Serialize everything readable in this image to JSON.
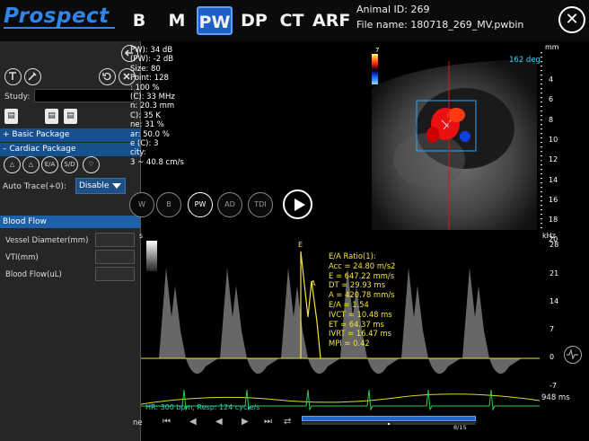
{
  "logo": "Prospect",
  "modes": [
    {
      "label": "B",
      "active": false
    },
    {
      "label": "M",
      "active": false
    },
    {
      "label": "PW",
      "active": true
    },
    {
      "label": "DP",
      "active": false
    },
    {
      "label": "CT",
      "active": false
    },
    {
      "label": "ARF",
      "active": false
    }
  ],
  "animal_id": "Animal ID: 269",
  "file_name": "File name: 180718_269_MV.pwbin",
  "close_label": "✕",
  "left_panel": {
    "study_label": "Study:",
    "study_value": "",
    "basic_package": "+  Basic Package",
    "cardiac_package": "–  Cardiac Package",
    "tri_buttons": [
      "",
      "",
      "E/A",
      "S/D",
      ""
    ],
    "auto_trace_label": "Auto Trace(+0):",
    "auto_trace_value": "Disable",
    "blood_flow_header": "Blood Flow",
    "blood_flow_rows": [
      {
        "label": "Vessel Diameter(mm)",
        "value": ""
      },
      {
        "label": "VTI(mm)",
        "value": ""
      },
      {
        "label": "Blood Flow(uL)",
        "value": ""
      }
    ]
  },
  "params_text": "PW): 34 dB\n(PW): -2 dB\nSize: 80\nPoint: 128\n: 100 %\n(C): 33 MHz\nn: 20.3 mm\nC): 35 K\nne: 31 %\nar: 50.0 %\ne (C): 3\ncity:\n3 ~ 40.8 cm/s",
  "angle": "162 deg",
  "color_scale_top": "7",
  "depth_unit": "mm",
  "depth_ticks": [
    "4",
    "6",
    "8",
    "10",
    "12",
    "14",
    "16",
    "18",
    "20"
  ],
  "control_buttons": [
    {
      "label": "W",
      "on": false
    },
    {
      "label": "B",
      "on": false
    },
    {
      "label": "PW",
      "on": true
    },
    {
      "label": "AD",
      "on": false
    },
    {
      "label": "TDI",
      "on": false
    }
  ],
  "doppler": {
    "unit": "kHz",
    "ticks": [
      "28",
      "21",
      "14",
      "7",
      "0",
      "-7"
    ],
    "scale_short": "s",
    "peak_e": "E",
    "peak_a": "A"
  },
  "ea_text": "E/A Ratio(1):\nAcc = 24.80 m/s2\nE = 647.22 mm/s\nDT = 29.93 ms\nA = 420.78 mm/s\nE/A = 1.54\nIVCT = 10.48 ms\nET = 64.37 ms\nIVRT = 16.47 ms\nMPI = 0.42",
  "hr_text": "HR: 300 bpm, Resp: 124 cycle/s",
  "time_ms": "948 ms",
  "frame": "8/15",
  "ne_text": "ne",
  "transport": [
    "⏮",
    "◀",
    "◀",
    "▶",
    "⏭",
    "⇄"
  ],
  "colors": {
    "accent": "#2f86e8",
    "mode_active": "#1e5fc7",
    "measure": "#f4e43a",
    "ecg": "#2bd14a"
  }
}
